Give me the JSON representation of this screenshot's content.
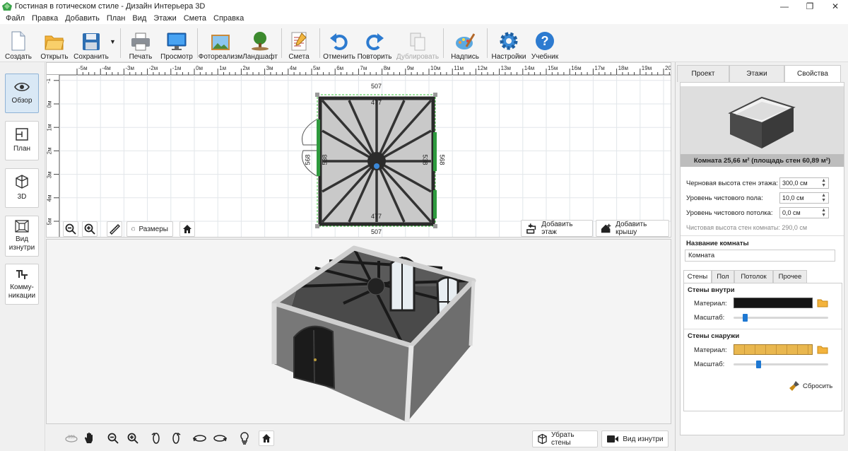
{
  "window": {
    "title": "Гостиная в готическом стиле - Дизайн Интерьера 3D"
  },
  "menu": [
    "Файл",
    "Правка",
    "Добавить",
    "План",
    "Вид",
    "Этажи",
    "Смета",
    "Справка"
  ],
  "toolbar": {
    "create": "Создать",
    "open": "Открыть",
    "save": "Сохранить",
    "print": "Печать",
    "preview": "Просмотр",
    "photo": "Фотореализм",
    "landscape": "Ландшафт",
    "estimate": "Смета",
    "undo": "Отменить",
    "redo": "Повторить",
    "duplicate": "Дублировать",
    "caption": "Надпись",
    "settings": "Настройки",
    "tutorial": "Учебник"
  },
  "leftbar": {
    "overview": "Обзор",
    "plan": "План",
    "view3d": "3D",
    "inside_1": "Вид",
    "inside_2": "изнутри",
    "comm_1": "Комму-",
    "comm_2": "никации"
  },
  "plan": {
    "ruler_x": [
      "-5м",
      "-4м",
      "-3м",
      "-2м",
      "-1м",
      "0м",
      "1м",
      "2м",
      "3м",
      "4м",
      "5м",
      "6м",
      "7м",
      "8м",
      "9м",
      "10м",
      "11м",
      "12м",
      "13м",
      "14м",
      "15м",
      "16м",
      "17м",
      "18м",
      "19м",
      "20м"
    ],
    "ruler_y": [
      "-1",
      "0м",
      "1м",
      "2м",
      "3м",
      "4м",
      "5м"
    ],
    "dim_top_outer": "507",
    "dim_bottom_outer": "507",
    "dim_top_inner": "477",
    "dim_bottom_inner": "477",
    "dim_left_outer": "568",
    "dim_right_outer": "568",
    "dim_left_inner": "538",
    "dim_right_inner": "538",
    "sizes_button": "Размеры",
    "add_floor": "Добавить этаж",
    "add_roof": "Добавить крышу"
  },
  "bottom": {
    "remove_walls": "Убрать стены",
    "inside_view": "Вид изнутри"
  },
  "props": {
    "tabs": [
      "Проект",
      "Этажи",
      "Свойства"
    ],
    "room_caption": "Комната 25,66 м² (площадь стен 60,89 м²)",
    "rough_height_label": "Черновая высота стен этажа:",
    "rough_height": "300,0 см",
    "floor_level_label": "Уровень чистового пола:",
    "floor_level": "10,0 см",
    "ceiling_level_label": "Уровень чистового потолка:",
    "ceiling_level": "0,0 см",
    "clean_height": "Чистовая высота стен комнаты: 290,0 см",
    "room_name_label": "Название комнаты",
    "room_name": "Комната",
    "subtabs": [
      "Стены",
      "Пол",
      "Потолок",
      "Прочее"
    ],
    "walls_inside": "Стены внутри",
    "walls_outside": "Стены снаружи",
    "material_label": "Материал:",
    "scale_label": "Масштаб:",
    "inside_scale": 0.12,
    "outside_scale": 0.26,
    "reset": "Сбросить"
  },
  "colors": {
    "accent": "#1e78d2",
    "wall_dark": "#2b2b2b",
    "wall_green": "#2e9a3e",
    "brick": "#e9b74f"
  }
}
